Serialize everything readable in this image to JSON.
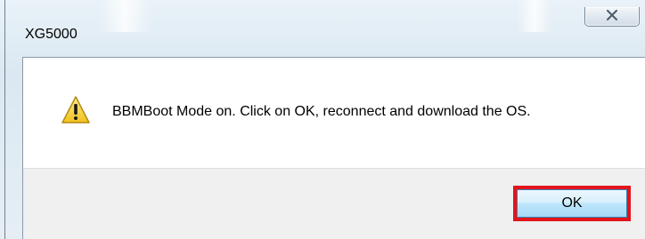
{
  "window": {
    "title": "XG5000",
    "close_icon": "close-icon"
  },
  "dialog": {
    "icon": "warning-icon",
    "message": "BBMBoot Mode on. Click on OK, reconnect and download the OS.",
    "ok_label": "OK"
  },
  "colors": {
    "highlight": "#e3141b",
    "warning_fill": "#f7d23a",
    "button_area": "#f0f0f0"
  }
}
